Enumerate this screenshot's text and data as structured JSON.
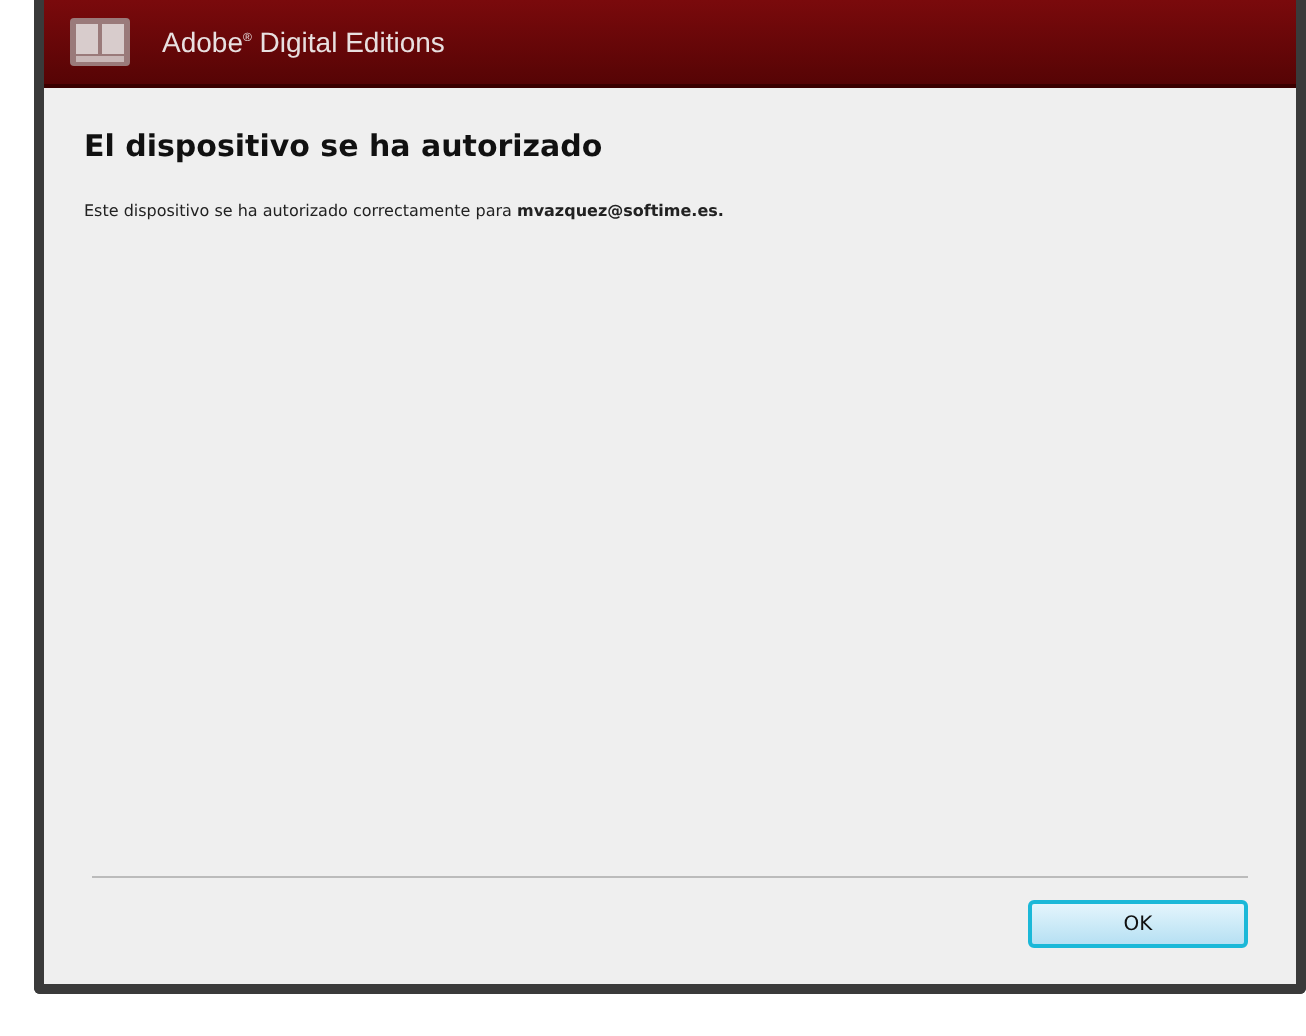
{
  "window": {
    "title": "Adobe",
    "title_mark": "®",
    "title_rest": "Digital Editions"
  },
  "heading": "El dispositivo se ha autorizado",
  "message": "Este dispositivo se ha autorizado correctamente para **mvazquez@softime.es.**",
  "buttons": [
    {
      "label": "OK",
      "selected": true
    }
  ]
}
